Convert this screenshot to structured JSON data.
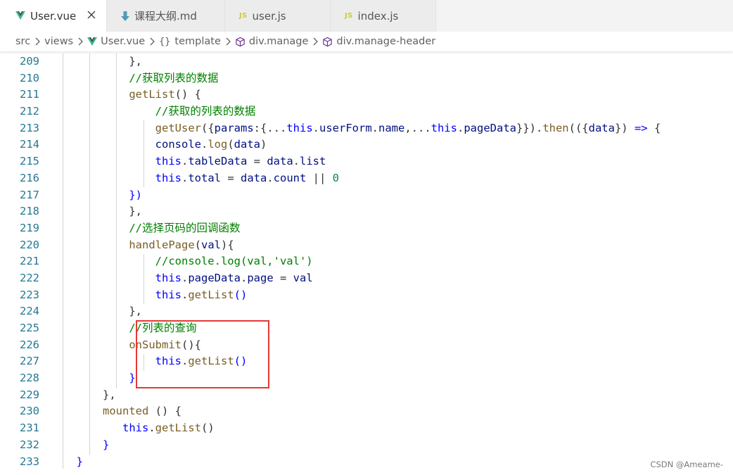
{
  "tabs": [
    {
      "label": "User.vue",
      "icon": "vue-icon",
      "active": true
    },
    {
      "label": "课程大纲.md",
      "icon": "markdown-icon",
      "active": false
    },
    {
      "label": "user.js",
      "icon": "js-icon",
      "badge": "JS",
      "active": false
    },
    {
      "label": "index.js",
      "icon": "js-icon",
      "badge": "JS",
      "active": false
    }
  ],
  "breadcrumb": [
    {
      "label": "src"
    },
    {
      "label": "views"
    },
    {
      "label": "User.vue",
      "icon": "vue-icon"
    },
    {
      "label": "template",
      "icon": "braces-icon",
      "glyph": "{}"
    },
    {
      "label": "div.manage",
      "icon": "cube-icon"
    },
    {
      "label": "div.manage-header",
      "icon": "cube-icon"
    }
  ],
  "editor": {
    "line_numbers": [
      "209",
      "210",
      "211",
      "212",
      "213",
      "214",
      "215",
      "216",
      "217",
      "218",
      "219",
      "220",
      "221",
      "222",
      "223",
      "224",
      "225",
      "226",
      "227",
      "228",
      "229",
      "230",
      "231",
      "232",
      "233"
    ],
    "lines": [
      {
        "indent": "          ",
        "tokens": [
          {
            "t": "},",
            "c": "p"
          }
        ]
      },
      {
        "indent": "          ",
        "tokens": [
          {
            "t": "//获取列表的数据",
            "c": "cm"
          }
        ]
      },
      {
        "indent": "          ",
        "tokens": [
          {
            "t": "getList",
            "c": "fn"
          },
          {
            "t": "() {",
            "c": "p"
          }
        ]
      },
      {
        "indent": "              ",
        "tokens": [
          {
            "t": "//获取的列表的数据",
            "c": "cm"
          }
        ]
      },
      {
        "indent": "              ",
        "tokens": [
          {
            "t": "getUser",
            "c": "fn"
          },
          {
            "t": "({",
            "c": "p"
          },
          {
            "t": "params",
            "c": "v"
          },
          {
            "t": ":{...",
            "c": "p"
          },
          {
            "t": "this",
            "c": "k"
          },
          {
            "t": ".",
            "c": "p"
          },
          {
            "t": "userForm",
            "c": "v"
          },
          {
            "t": ".",
            "c": "p"
          },
          {
            "t": "name",
            "c": "v"
          },
          {
            "t": ",...",
            "c": "p"
          },
          {
            "t": "this",
            "c": "k"
          },
          {
            "t": ".",
            "c": "p"
          },
          {
            "t": "pageData",
            "c": "v"
          },
          {
            "t": "}}).",
            "c": "p"
          },
          {
            "t": "then",
            "c": "fn"
          },
          {
            "t": "(({",
            "c": "p"
          },
          {
            "t": "data",
            "c": "v"
          },
          {
            "t": "}) ",
            "c": "p"
          },
          {
            "t": "=>",
            "c": "k"
          },
          {
            "t": " {",
            "c": "p"
          }
        ]
      },
      {
        "indent": "              ",
        "tokens": [
          {
            "t": "console",
            "c": "v"
          },
          {
            "t": ".",
            "c": "p"
          },
          {
            "t": "log",
            "c": "fn"
          },
          {
            "t": "(",
            "c": "p"
          },
          {
            "t": "data",
            "c": "v"
          },
          {
            "t": ")",
            "c": "p"
          }
        ]
      },
      {
        "indent": "              ",
        "tokens": [
          {
            "t": "this",
            "c": "k"
          },
          {
            "t": ".",
            "c": "p"
          },
          {
            "t": "tableData",
            "c": "v"
          },
          {
            "t": " = ",
            "c": "p"
          },
          {
            "t": "data",
            "c": "v"
          },
          {
            "t": ".",
            "c": "p"
          },
          {
            "t": "list",
            "c": "v"
          }
        ]
      },
      {
        "indent": "              ",
        "tokens": [
          {
            "t": "this",
            "c": "k"
          },
          {
            "t": ".",
            "c": "p"
          },
          {
            "t": "total",
            "c": "v"
          },
          {
            "t": " = ",
            "c": "p"
          },
          {
            "t": "data",
            "c": "v"
          },
          {
            "t": ".",
            "c": "p"
          },
          {
            "t": "count",
            "c": "v"
          },
          {
            "t": " || ",
            "c": "p"
          },
          {
            "t": "0",
            "c": "num"
          }
        ]
      },
      {
        "indent": "          ",
        "tokens": [
          {
            "t": "})",
            "c": "k"
          }
        ]
      },
      {
        "indent": "          ",
        "tokens": [
          {
            "t": "},",
            "c": "p"
          }
        ]
      },
      {
        "indent": "          ",
        "tokens": [
          {
            "t": "//选择页码的回调函数",
            "c": "cm"
          }
        ]
      },
      {
        "indent": "          ",
        "tokens": [
          {
            "t": "handlePage",
            "c": "fn"
          },
          {
            "t": "(",
            "c": "p"
          },
          {
            "t": "val",
            "c": "v"
          },
          {
            "t": "){",
            "c": "p"
          }
        ]
      },
      {
        "indent": "              ",
        "tokens": [
          {
            "t": "//console.log(val,'val')",
            "c": "cm"
          }
        ]
      },
      {
        "indent": "              ",
        "tokens": [
          {
            "t": "this",
            "c": "k"
          },
          {
            "t": ".",
            "c": "p"
          },
          {
            "t": "pageData",
            "c": "v"
          },
          {
            "t": ".",
            "c": "p"
          },
          {
            "t": "page",
            "c": "v"
          },
          {
            "t": " = ",
            "c": "p"
          },
          {
            "t": "val",
            "c": "v"
          }
        ]
      },
      {
        "indent": "              ",
        "tokens": [
          {
            "t": "this",
            "c": "k"
          },
          {
            "t": ".",
            "c": "p"
          },
          {
            "t": "getList",
            "c": "fn"
          },
          {
            "t": "()",
            "c": "k"
          }
        ]
      },
      {
        "indent": "          ",
        "tokens": [
          {
            "t": "},",
            "c": "p"
          }
        ]
      },
      {
        "indent": "          ",
        "tokens": [
          {
            "t": "//列表的查询",
            "c": "cm"
          }
        ]
      },
      {
        "indent": "          ",
        "tokens": [
          {
            "t": "onSubmit",
            "c": "fn"
          },
          {
            "t": "(){",
            "c": "p"
          }
        ]
      },
      {
        "indent": "              ",
        "tokens": [
          {
            "t": "this",
            "c": "k"
          },
          {
            "t": ".",
            "c": "p"
          },
          {
            "t": "getList",
            "c": "fn"
          },
          {
            "t": "()",
            "c": "k"
          }
        ]
      },
      {
        "indent": "          ",
        "tokens": [
          {
            "t": "}",
            "c": "k"
          }
        ]
      },
      {
        "indent": "      ",
        "tokens": [
          {
            "t": "},",
            "c": "p"
          }
        ]
      },
      {
        "indent": "      ",
        "tokens": [
          {
            "t": "mounted",
            "c": "fn"
          },
          {
            "t": " () {",
            "c": "p"
          }
        ]
      },
      {
        "indent": "         ",
        "tokens": [
          {
            "t": "this",
            "c": "k"
          },
          {
            "t": ".",
            "c": "p"
          },
          {
            "t": "getList",
            "c": "fn"
          },
          {
            "t": "()",
            "c": "p"
          }
        ]
      },
      {
        "indent": "      ",
        "tokens": [
          {
            "t": "}",
            "c": "k"
          }
        ]
      },
      {
        "indent": "  ",
        "tokens": [
          {
            "t": "}",
            "c": "k"
          }
        ]
      }
    ]
  },
  "watermark": "CSDN @Ameame-",
  "colors": {
    "keyword": "#0000ff",
    "variable": "#001080",
    "function": "#795e26",
    "comment": "#008000",
    "number": "#098658",
    "line_number": "#237893",
    "highlight_border": "#e53935",
    "vue_green": "#41b883",
    "js_yellow": "#cbcb41",
    "md_blue": "#519aba"
  }
}
